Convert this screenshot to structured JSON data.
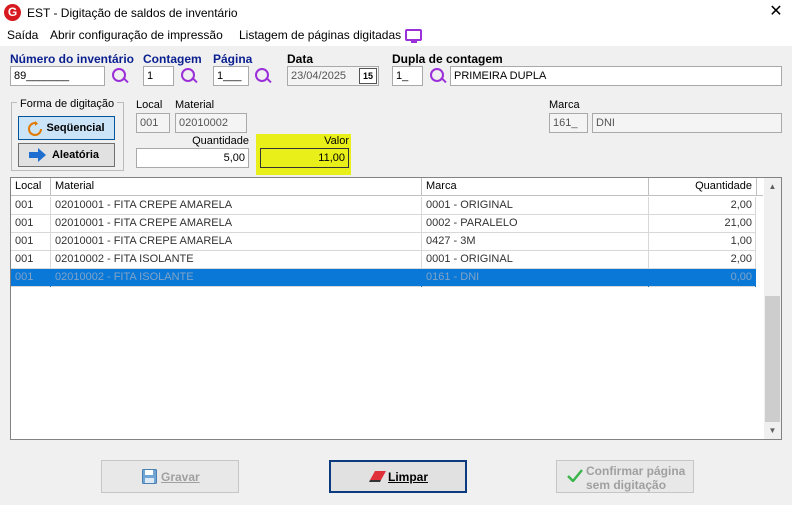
{
  "window": {
    "title": "EST - Digitação de saldos de inventário",
    "close": "✕"
  },
  "menu": {
    "items": [
      "Saída",
      "Abrir configuração de impressão",
      "Listagem de páginas digitadas"
    ]
  },
  "header": {
    "inventario": {
      "label": "Número do inventário",
      "value": "89_______"
    },
    "contagem": {
      "label": "Contagem",
      "value": "1"
    },
    "pagina": {
      "label": "Página",
      "value": "1___"
    },
    "data": {
      "label": "Data",
      "value": "23/04/2025",
      "cal_icon": "15"
    },
    "dupla": {
      "label": "Dupla de contagem",
      "code": "1_",
      "name": "PRIMEIRA DUPLA"
    }
  },
  "forma": {
    "title": "Forma de digitação",
    "sequencial": "Seqüencial",
    "aleatoria": "Aleatória"
  },
  "entry": {
    "local_label": "Local",
    "local_value": "001",
    "material_label": "Material",
    "material_value": "02010002",
    "marca_label": "Marca",
    "marca_code": "161_",
    "marca_name": "DNI",
    "quantidade_label": "Quantidade",
    "quantidade_value": "5,00",
    "valor_label": "Valor",
    "valor_value": "11,00"
  },
  "grid": {
    "headers": [
      "Local",
      "Material",
      "Marca",
      "Quantidade"
    ],
    "rows": [
      [
        "001",
        "02010001 - FITA CREPE AMARELA",
        "0001 - ORIGINAL",
        "2,00"
      ],
      [
        "001",
        "02010001 - FITA CREPE AMARELA",
        "0002 - PARALELO",
        "21,00"
      ],
      [
        "001",
        "02010001 - FITA CREPE AMARELA",
        "0427 - 3M",
        "1,00"
      ],
      [
        "001",
        "02010002 - FITA ISOLANTE",
        "0001 - ORIGINAL",
        "2,00"
      ],
      [
        "001",
        "02010002 - FITA ISOLANTE",
        "0161 - DNI",
        "0,00"
      ]
    ],
    "selected_row": 4
  },
  "buttons": {
    "gravar": "Gravar",
    "limpar": "Limpar",
    "confirmar_line1": "Confirmar página",
    "confirmar_line2": "sem digitação"
  },
  "colors": {
    "accent_purple": "#9b30d9",
    "highlight": "#e9ef18",
    "selection": "#0a78d7",
    "label_blue": "#0a1f8f"
  }
}
